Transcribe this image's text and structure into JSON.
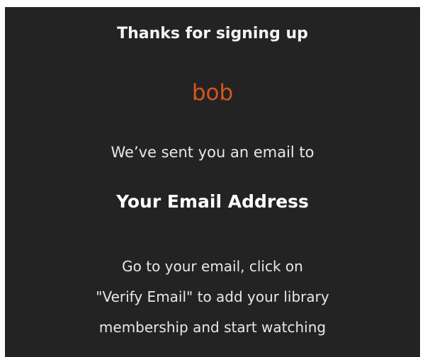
{
  "signup_confirmation": {
    "title": "Thanks for signing up",
    "username": "bob",
    "sent_text": "We’ve sent you an email to",
    "email_address": "Your Email Address",
    "instructions": [
      "Go to your email, click on",
      "\"Verify Email\" to add your library",
      "membership and start watching"
    ]
  },
  "colors": {
    "background": "#232323",
    "username_accent": "#d4561f",
    "text": "#f2f2f2"
  }
}
